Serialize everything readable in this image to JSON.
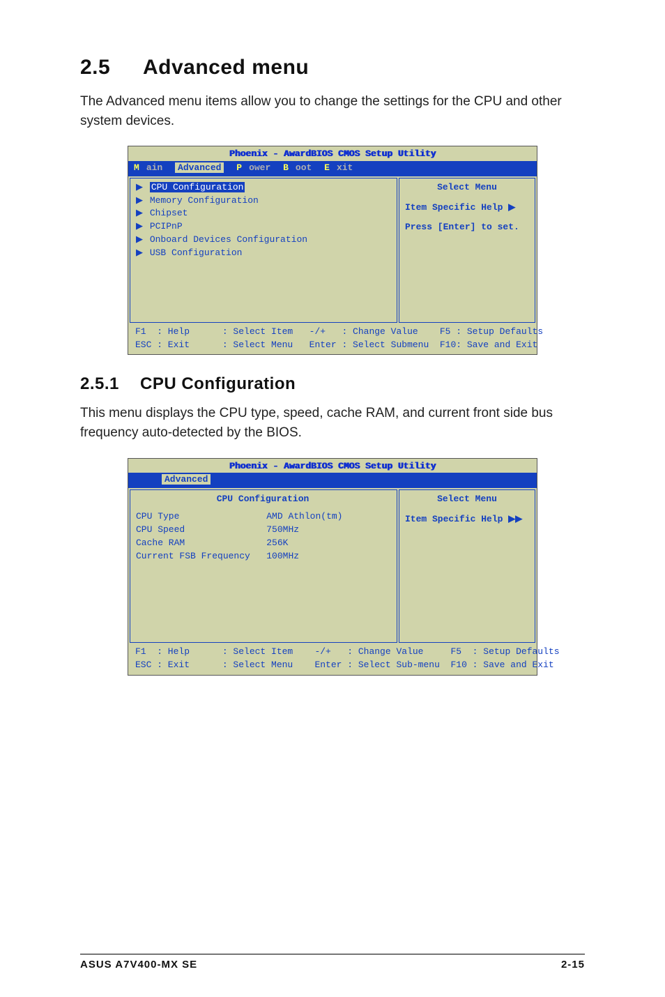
{
  "section": {
    "number": "2.5",
    "title": "Advanced menu",
    "intro": "The Advanced menu items allow you to change the settings for the CPU and other system devices."
  },
  "bios1": {
    "title": "Phoenix - AwardBIOS CMOS Setup Utility",
    "tabs": {
      "main": "Main",
      "advanced": "Advanced",
      "power": "Power",
      "boot": "Boot",
      "exit": "Exit"
    },
    "items": [
      "CPU Configuration",
      "Memory Configuration",
      "Chipset",
      "PCIPnP",
      "Onboard Devices Configuration",
      "USB Configuration"
    ],
    "right": {
      "head": "Select Menu",
      "line1": "Item Specific Help ▶",
      "line2": "Press [Enter] to set."
    },
    "footer": {
      "r1": "F1  : Help      : Select Item   -/+   : Change Value    F5 : Setup Defaults",
      "r2": "ESC : Exit      : Select Menu   Enter : Select Submenu  F10: Save and Exit"
    }
  },
  "sub": {
    "number": "2.5.1",
    "title": "CPU Configuration",
    "intro": "This menu displays the CPU type, speed, cache RAM, and current front side bus frequency auto-detected by the BIOS."
  },
  "bios2": {
    "title": "Phoenix - AwardBIOS CMOS Setup Utility",
    "tab": "Advanced",
    "subtitle": "CPU Configuration",
    "rows": [
      {
        "k": "CPU Type",
        "v": "AMD Athlon(tm)"
      },
      {
        "k": "CPU Speed",
        "v": "750MHz"
      },
      {
        "k": "Cache RAM",
        "v": "256K"
      },
      {
        "k": "Current FSB Frequency",
        "v": "100MHz"
      }
    ],
    "right": {
      "head": "Select Menu",
      "line1": "Item Specific Help ▶▶"
    },
    "footer": {
      "r1": "F1  : Help      : Select Item    -/+   : Change Value     F5  : Setup Defaults",
      "r2": "ESC : Exit      : Select Menu    Enter : Select Sub-menu  F10 : Save and Exit"
    }
  },
  "pagefoot": {
    "left": "ASUS A7V400-MX SE",
    "right": "2-15"
  }
}
